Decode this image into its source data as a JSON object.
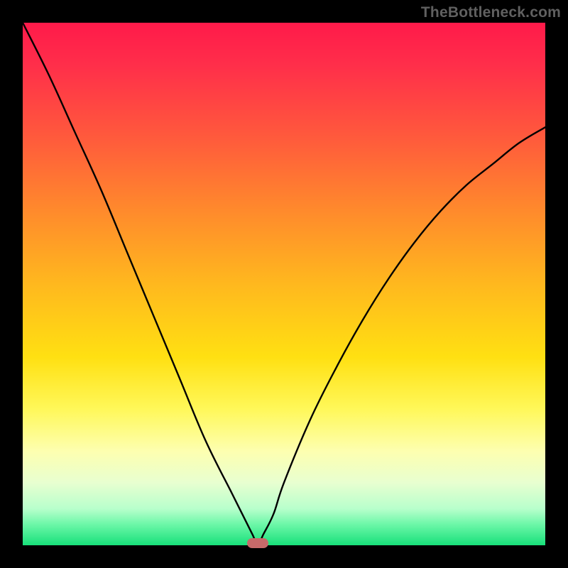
{
  "watermark": "TheBottleneck.com",
  "chart_data": {
    "type": "line",
    "title": "",
    "xlabel": "",
    "ylabel": "",
    "xlim": [
      0,
      100
    ],
    "ylim": [
      0,
      100
    ],
    "grid": false,
    "legend": false,
    "series": [
      {
        "name": "bottleneck-curve",
        "x": [
          0,
          5,
          10,
          15,
          20,
          25,
          30,
          35,
          40,
          42,
          44,
          45,
          46,
          48,
          50,
          55,
          60,
          65,
          70,
          75,
          80,
          85,
          90,
          95,
          100
        ],
        "values": [
          100,
          90,
          79,
          68,
          56,
          44,
          32,
          20,
          10,
          6,
          2,
          0,
          2,
          6,
          12,
          24,
          34,
          43,
          51,
          58,
          64,
          69,
          73,
          77,
          80
        ]
      }
    ],
    "marker_value": 0,
    "marker_position_x": 45,
    "background_gradient": {
      "top": "#ff1a4a",
      "upper_mid": "#ff8a2c",
      "mid": "#ffe012",
      "lower_mid": "#fdffb0",
      "bottom": "#18e07a"
    },
    "annotations": []
  }
}
